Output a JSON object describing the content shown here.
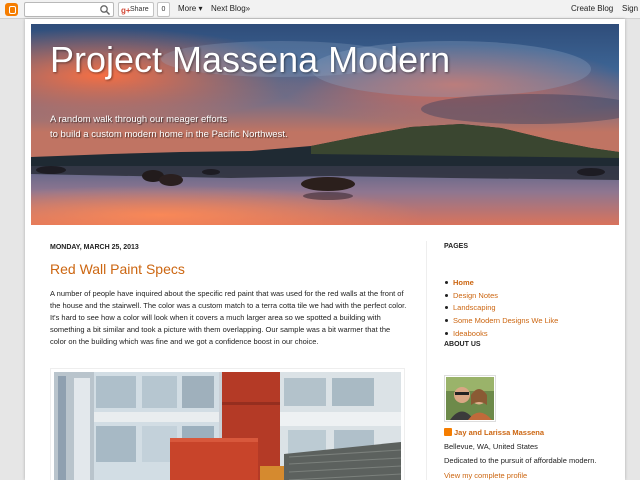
{
  "navbar": {
    "share_label": "Share",
    "share_count": "0",
    "more_label": "More ▾",
    "next_blog_label": "Next Blog»",
    "create_blog_label": "Create Blog",
    "sign_in_label": "Sign"
  },
  "header": {
    "title": "Project Massena Modern",
    "description_line1": "A random walk through our meager efforts",
    "description_line2": "to build a custom modern home in the Pacific Northwest."
  },
  "post": {
    "date": "MONDAY, MARCH 25, 2013",
    "title": "Red Wall Paint Specs",
    "body": "A number of people have inquired about the specific red paint that was used for the red walls at the front of the house and the stairwell. The color was a custom match to a terra cotta tile we had with the perfect color. It's hard to see how a color will look when it covers a much larger area so we spotted a building with something a bit similar and took a picture with them overlapping. Our sample was a bit warmer that the color on the building which was fine and we got a confidence boost in our choice."
  },
  "sidebar": {
    "pages_title": "PAGES",
    "pages": [
      "Home",
      "Design Notes",
      "Landscaping",
      "Some Modern Designs We Like",
      "Ideabooks"
    ],
    "about_title": "ABOUT US",
    "profile_name": "Jay and Larissa Massena",
    "profile_location": "Bellevue, WA, United States",
    "profile_about": "Dedicated to the pursuit of affordable modern.",
    "profile_link": "View my complete profile"
  },
  "colors": {
    "accent": "#cc6611",
    "blogger_orange": "#f57d00"
  }
}
